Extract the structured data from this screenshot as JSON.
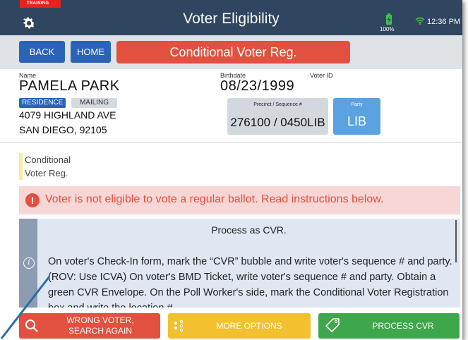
{
  "header": {
    "training_badge": "TRAINING",
    "title": "Voter Eligibility",
    "battery": "100%",
    "time": "12:36 PM",
    "icons": [
      "gear-icon",
      "battery-icon",
      "wifi-icon"
    ]
  },
  "nav": {
    "back_label": "BACK",
    "home_label": "HOME",
    "status": "Conditional Voter Reg."
  },
  "voter": {
    "name_label": "Name",
    "name": "PAMELA PARK",
    "birthdate_label": "Birthdate",
    "birthdate": "08/23/1999",
    "voterid_label": "Voter ID",
    "tag_residence": "RESIDENCE",
    "tag_mailing": "MAILING",
    "address_line1": "4079 HIGHLAND AVE",
    "address_line2": "SAN DIEGO, 92105",
    "precinct_label": "Precinct / Sequence #",
    "precinct_value": "276100 / 0450LIB",
    "party_label": "Party",
    "party_value": "LIB"
  },
  "conditional_note": {
    "line1": "Conditional",
    "line2": "Voter Reg."
  },
  "alert": {
    "icon": "!",
    "text": "Voter is not eligible to vote a regular ballot.  Read instructions below."
  },
  "info": {
    "icon": "i",
    "title": "Process as CVR.",
    "body": "On voter's Check-In form, mark the “CVR” bubble and write voter's sequence # and party. (ROV: Use ICVA) On voter's BMD Ticket, write voter's sequence # and party. Obtain a green CVR Envelope. On the Poll Worker's side, mark the Conditional Voter Registration box and write the location #"
  },
  "buttons": {
    "wrong_voter_line1": "WRONG VOTER,",
    "wrong_voter_line2": "SEARCH AGAIN",
    "more_options": "MORE OPTIONS",
    "process_cvr": "PROCESS CVR"
  },
  "colors": {
    "header_bg": "#2f4560",
    "nav_button": "#2b63b8",
    "status_red": "#e2503f",
    "party_blue": "#5aa2e0",
    "alert_bg": "#f7d6d6",
    "info_bg": "#dfe7f3",
    "wrong_btn": "#e2503f",
    "more_btn": "#f3c02f",
    "cvr_btn": "#3ea64b",
    "annotation_arrow": "#2a6e9c"
  }
}
